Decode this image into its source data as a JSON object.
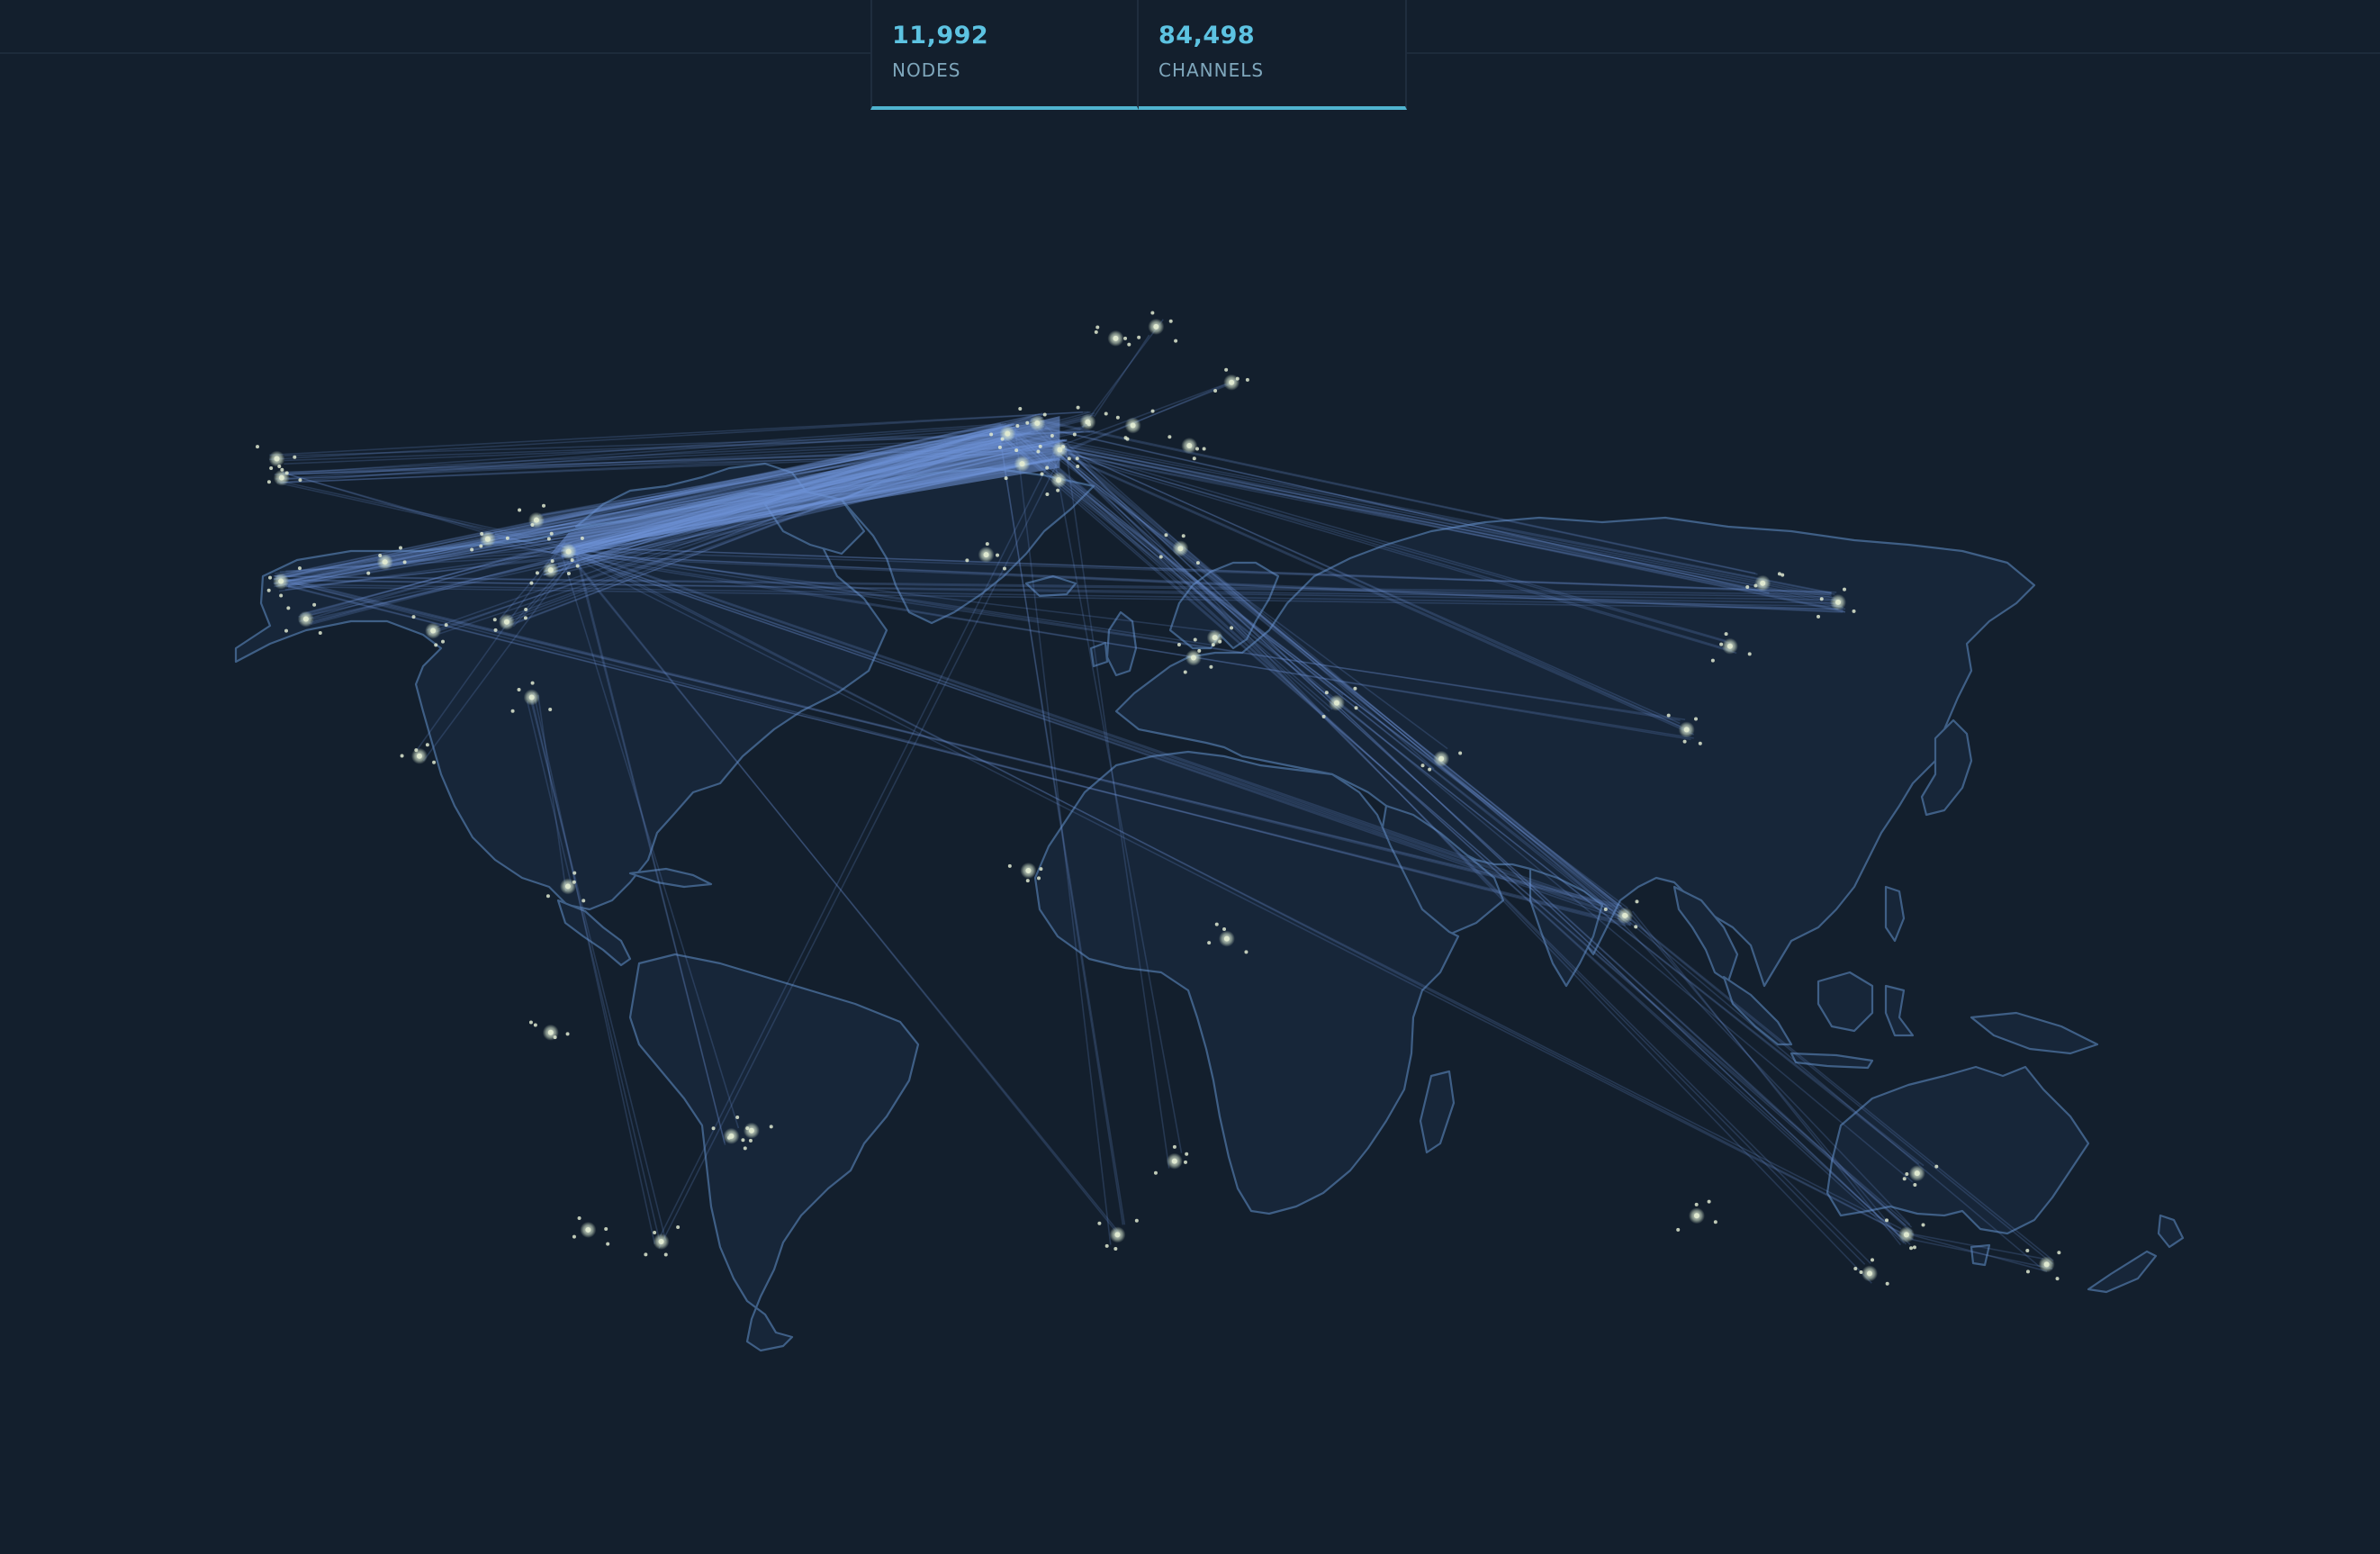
{
  "stats": {
    "nodes": {
      "value": "11,992",
      "label": "NODES"
    },
    "channels": {
      "value": "84,498",
      "label": "CHANNELS"
    }
  },
  "colors": {
    "background": "#131f2d",
    "land_fill": "#172639",
    "land_stroke": "#3f5f86",
    "channel_line": "#6f93d8",
    "node_dot": "#dfe9d0",
    "accent": "#5dc3e2"
  },
  "map": {
    "projection": "miller-like world projection",
    "hubs": {
      "san-francisco": [
        -122.4,
        37.8
      ],
      "seattle": [
        -122.3,
        47.6
      ],
      "vancouver": [
        -123.1,
        49.3
      ],
      "los-angeles": [
        -118.2,
        34.0
      ],
      "denver": [
        -104.9,
        39.7
      ],
      "chicago": [
        -87.6,
        41.9
      ],
      "toronto": [
        -79.4,
        43.7
      ],
      "new-york": [
        -74.0,
        40.7
      ],
      "washington": [
        -77.0,
        38.9
      ],
      "atlanta": [
        -84.4,
        33.7
      ],
      "miami": [
        -80.2,
        25.8
      ],
      "dallas": [
        -96.8,
        32.8
      ],
      "mexico-city": [
        -99.1,
        19.4
      ],
      "london": [
        -0.1,
        51.5
      ],
      "paris": [
        2.35,
        48.85
      ],
      "amsterdam": [
        4.9,
        52.4
      ],
      "frankfurt": [
        8.7,
        50.1
      ],
      "berlin": [
        13.4,
        52.5
      ],
      "zurich": [
        8.5,
        47.4
      ],
      "madrid": [
        -3.7,
        40.4
      ],
      "stockholm": [
        18.1,
        59.3
      ],
      "helsinki": [
        24.9,
        60.2
      ],
      "warsaw": [
        21.0,
        52.2
      ],
      "moscow": [
        37.6,
        55.8
      ],
      "kyiv": [
        30.5,
        50.45
      ],
      "istanbul": [
        29.0,
        41.0
      ],
      "dubai": [
        55.3,
        25.2
      ],
      "mumbai": [
        72.9,
        19.1
      ],
      "singapore": [
        103.8,
        1.35
      ],
      "hong-kong": [
        114.2,
        22.3
      ],
      "shanghai": [
        121.5,
        31.2
      ],
      "seoul": [
        127.0,
        37.6
      ],
      "tokyo": [
        139.7,
        35.7
      ],
      "sydney": [
        151.2,
        -33.9
      ],
      "melbourne": [
        145.0,
        -37.8
      ],
      "brisbane": [
        153.0,
        -27.5
      ],
      "perth": [
        115.9,
        -31.95
      ],
      "auckland": [
        174.8,
        -36.9
      ],
      "sao-paulo": [
        -46.6,
        -23.5
      ],
      "rio": [
        -43.2,
        -22.9
      ],
      "buenos-aires": [
        -58.4,
        -34.6
      ],
      "bogota": [
        -74.1,
        4.7
      ],
      "lima": [
        -77.0,
        -12.0
      ],
      "santiago": [
        -70.7,
        -33.4
      ],
      "cape-town": [
        18.4,
        -33.9
      ],
      "johannesburg": [
        28.0,
        -26.2
      ],
      "lagos": [
        3.4,
        6.5
      ],
      "nairobi": [
        36.8,
        -1.3
      ],
      "cairo": [
        31.2,
        30.0
      ],
      "tel-aviv": [
        34.8,
        32.1
      ]
    },
    "channels": [
      {
        "from": "new-york",
        "to": "london",
        "weight": 14
      },
      {
        "from": "new-york",
        "to": "frankfurt",
        "weight": 12
      },
      {
        "from": "new-york",
        "to": "amsterdam",
        "weight": 11
      },
      {
        "from": "new-york",
        "to": "paris",
        "weight": 9
      },
      {
        "from": "new-york",
        "to": "berlin",
        "weight": 9
      },
      {
        "from": "washington",
        "to": "london",
        "weight": 9
      },
      {
        "from": "washington",
        "to": "frankfurt",
        "weight": 8
      },
      {
        "from": "toronto",
        "to": "amsterdam",
        "weight": 7
      },
      {
        "from": "toronto",
        "to": "london",
        "weight": 7
      },
      {
        "from": "chicago",
        "to": "frankfurt",
        "weight": 8
      },
      {
        "from": "chicago",
        "to": "london",
        "weight": 7
      },
      {
        "from": "atlanta",
        "to": "london",
        "weight": 5
      },
      {
        "from": "san-francisco",
        "to": "london",
        "weight": 10
      },
      {
        "from": "san-francisco",
        "to": "frankfurt",
        "weight": 10
      },
      {
        "from": "san-francisco",
        "to": "amsterdam",
        "weight": 8
      },
      {
        "from": "seattle",
        "to": "frankfurt",
        "weight": 6
      },
      {
        "from": "seattle",
        "to": "london",
        "weight": 6
      },
      {
        "from": "vancouver",
        "to": "berlin",
        "weight": 5
      },
      {
        "from": "los-angeles",
        "to": "london",
        "weight": 6
      },
      {
        "from": "denver",
        "to": "frankfurt",
        "weight": 5
      },
      {
        "from": "dallas",
        "to": "amsterdam",
        "weight": 4
      },
      {
        "from": "new-york",
        "to": "tokyo",
        "weight": 6
      },
      {
        "from": "san-francisco",
        "to": "tokyo",
        "weight": 6
      },
      {
        "from": "frankfurt",
        "to": "tokyo",
        "weight": 6
      },
      {
        "from": "london",
        "to": "tokyo",
        "weight": 5
      },
      {
        "from": "amsterdam",
        "to": "seoul",
        "weight": 4
      },
      {
        "from": "frankfurt",
        "to": "shanghai",
        "weight": 4
      },
      {
        "from": "new-york",
        "to": "singapore",
        "weight": 6
      },
      {
        "from": "san-francisco",
        "to": "singapore",
        "weight": 6
      },
      {
        "from": "london",
        "to": "singapore",
        "weight": 5
      },
      {
        "from": "frankfurt",
        "to": "singapore",
        "weight": 5
      },
      {
        "from": "frankfurt",
        "to": "hong-kong",
        "weight": 4
      },
      {
        "from": "new-york",
        "to": "hong-kong",
        "weight": 4
      },
      {
        "from": "london",
        "to": "sydney",
        "weight": 4
      },
      {
        "from": "frankfurt",
        "to": "sydney",
        "weight": 4
      },
      {
        "from": "new-york",
        "to": "sydney",
        "weight": 3
      },
      {
        "from": "amsterdam",
        "to": "melbourne",
        "weight": 3
      },
      {
        "from": "london",
        "to": "brisbane",
        "weight": 3
      },
      {
        "from": "frankfurt",
        "to": "auckland",
        "weight": 3
      },
      {
        "from": "sydney",
        "to": "auckland",
        "weight": 3
      },
      {
        "from": "singapore",
        "to": "sydney",
        "weight": 3
      },
      {
        "from": "new-york",
        "to": "sao-paulo",
        "weight": 3
      },
      {
        "from": "miami",
        "to": "buenos-aires",
        "weight": 3
      },
      {
        "from": "frankfurt",
        "to": "buenos-aires",
        "weight": 2
      },
      {
        "from": "london",
        "to": "cape-town",
        "weight": 3
      },
      {
        "from": "frankfurt",
        "to": "johannesburg",
        "weight": 2
      },
      {
        "from": "new-york",
        "to": "cape-town",
        "weight": 2
      },
      {
        "from": "london",
        "to": "dubai",
        "weight": 3
      },
      {
        "from": "frankfurt",
        "to": "mumbai",
        "weight": 2
      },
      {
        "from": "new-york",
        "to": "tel-aviv",
        "weight": 2
      },
      {
        "from": "frankfurt",
        "to": "moscow",
        "weight": 3
      },
      {
        "from": "berlin",
        "to": "helsinki",
        "weight": 2
      },
      {
        "from": "new-york",
        "to": "san-francisco",
        "weight": 6
      },
      {
        "from": "new-york",
        "to": "chicago",
        "weight": 4
      },
      {
        "from": "seattle",
        "to": "new-york",
        "weight": 4
      },
      {
        "from": "los-angeles",
        "to": "new-york",
        "weight": 4
      },
      {
        "from": "atlanta",
        "to": "new-york",
        "weight": 3
      },
      {
        "from": "mexico-city",
        "to": "new-york",
        "weight": 2
      },
      {
        "from": "bogota",
        "to": "miami",
        "weight": 2
      }
    ]
  }
}
